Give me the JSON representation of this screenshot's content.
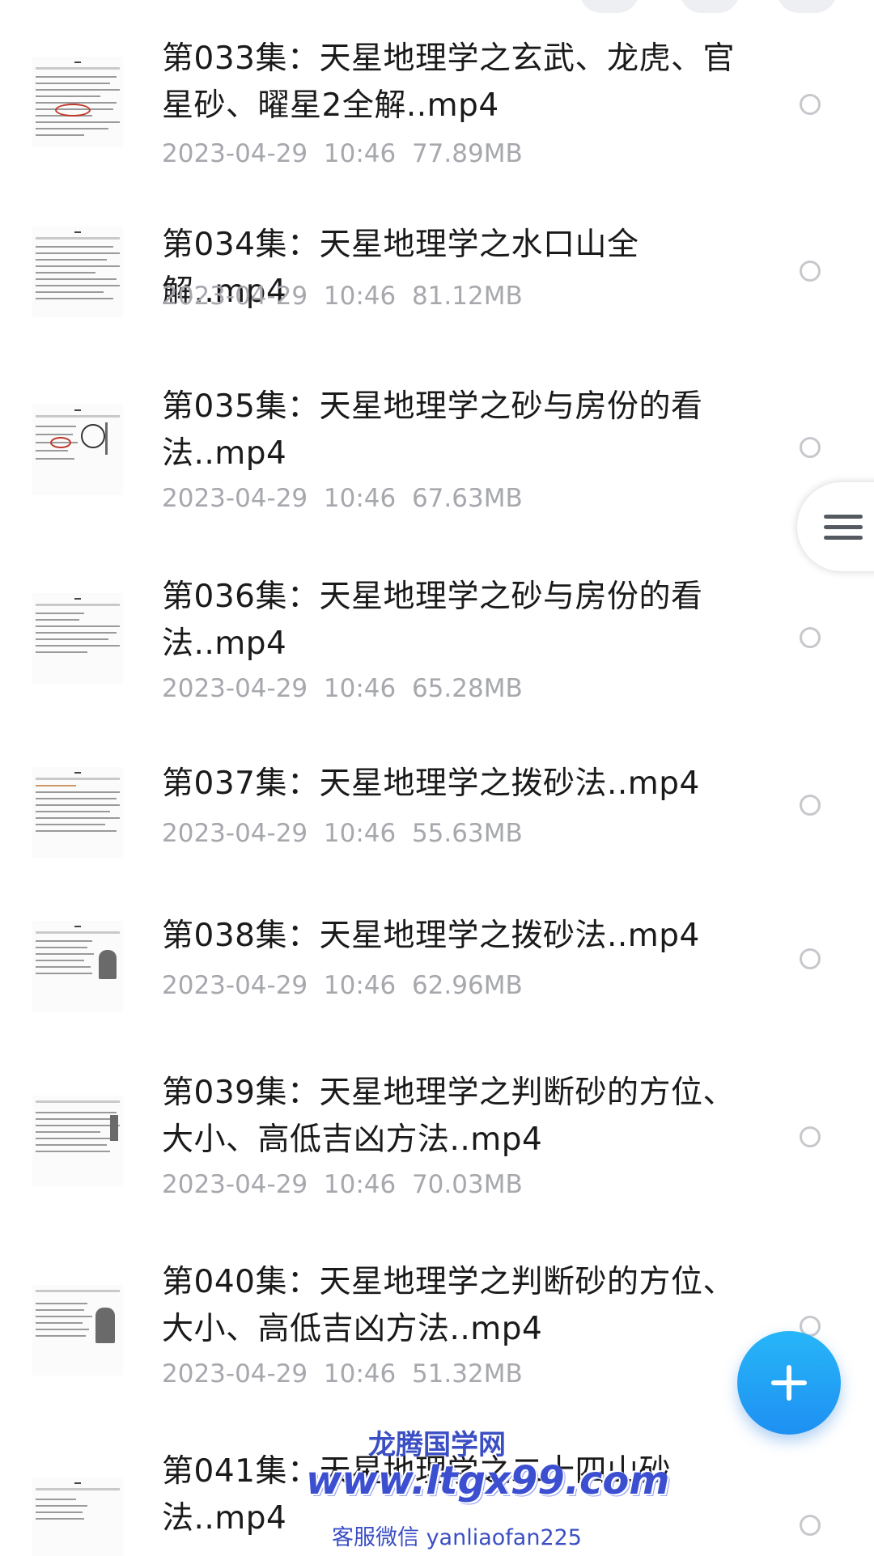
{
  "files": [
    {
      "name": "第033集：天星地理学之玄武、龙虎、官星砂、曜星2全解..mp4",
      "date": "2023-04-29",
      "time": "10:46",
      "size": "77.89MB"
    },
    {
      "name": "第034集：天星地理学之水口山全解..mp4",
      "date": "2023-04-29",
      "time": "10:46",
      "size": "81.12MB"
    },
    {
      "name": "第035集：天星地理学之砂与房份的看法..mp4",
      "date": "2023-04-29",
      "time": "10:46",
      "size": "67.63MB"
    },
    {
      "name": "第036集：天星地理学之砂与房份的看法..mp4",
      "date": "2023-04-29",
      "time": "10:46",
      "size": "65.28MB"
    },
    {
      "name": "第037集：天星地理学之拨砂法..mp4",
      "date": "2023-04-29",
      "time": "10:46",
      "size": "55.63MB"
    },
    {
      "name": "第038集：天星地理学之拨砂法..mp4",
      "date": "2023-04-29",
      "time": "10:46",
      "size": "62.96MB"
    },
    {
      "name": "第039集：天星地理学之判断砂的方位、大小、高低吉凶方法..mp4",
      "date": "2023-04-29",
      "time": "10:46",
      "size": "70.03MB"
    },
    {
      "name": "第040集：天星地理学之判断砂的方位、大小、高低吉凶方法..mp4",
      "date": "2023-04-29",
      "time": "10:46",
      "size": "51.32MB"
    },
    {
      "name": "第041集：天星地理学之二十四山砂法..mp4",
      "date": "",
      "time": "",
      "size": ""
    }
  ],
  "watermark": {
    "title": "龙腾国学网",
    "url": "www.ltgx99.com",
    "service": "客服微信 yanliaofan225"
  },
  "icons": {
    "menu": "menu-icon",
    "add": "plus-icon",
    "select": "radio-circle-icon"
  },
  "colors": {
    "fab": "#1e90f2",
    "meta_text": "#a6a8ad",
    "watermark": "#3b4fc4"
  }
}
